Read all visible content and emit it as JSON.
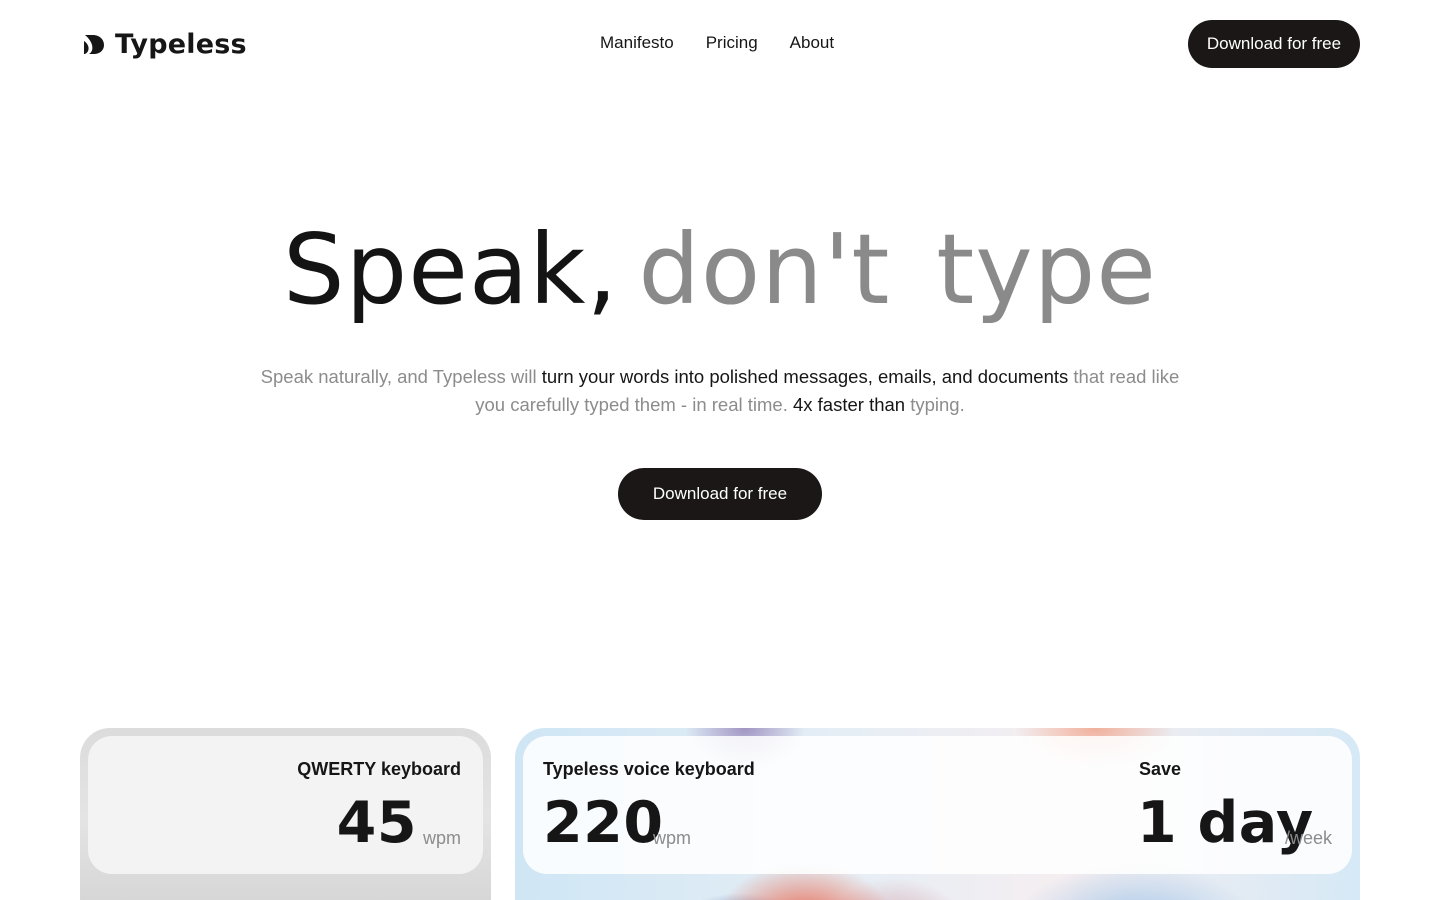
{
  "header": {
    "brand": "Typeless",
    "nav": [
      {
        "label": "Manifesto"
      },
      {
        "label": "Pricing"
      },
      {
        "label": "About"
      }
    ],
    "cta_label": "Download for free"
  },
  "hero": {
    "title_dark": "Speak,",
    "title_light": "don't type",
    "subtitle": {
      "part1": "Speak naturally, and Typeless will",
      "part2": "turn your words into polished messages, emails, and documents",
      "part3": "that read like you carefully typed them - in real time.",
      "part4": "4x faster than",
      "part5": "typing."
    },
    "cta_label": "Download for free"
  },
  "stats": {
    "qwerty": {
      "label": "QWERTY keyboard",
      "value": "45",
      "unit": "wpm"
    },
    "typeless": {
      "label": "Typeless voice keyboard",
      "value": "220",
      "unit": "wpm"
    },
    "save": {
      "label": "Save",
      "value": "1 day",
      "unit": "/week"
    }
  },
  "colors": {
    "primary_button": "#1b1717",
    "muted_text": "#8c8c8c",
    "heading_light": "#8a8a8a"
  },
  "icons": {
    "logo": "typeless-logo-icon"
  }
}
